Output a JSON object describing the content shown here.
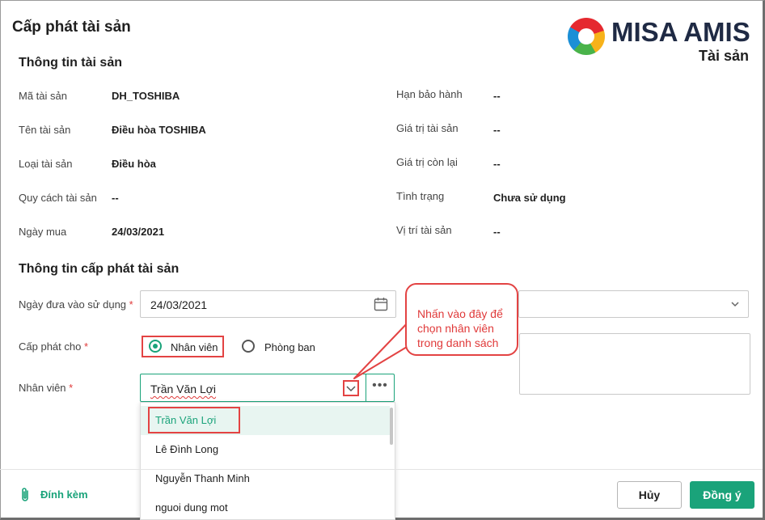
{
  "dialog": {
    "title": "Cấp phát tài sản"
  },
  "logo": {
    "brand": "MISA AMIS",
    "product": "Tài sản"
  },
  "asset_info": {
    "section_title": "Thông tin tài sản",
    "left": [
      {
        "label": "Mã tài sản",
        "value": "DH_TOSHIBA"
      },
      {
        "label": "Tên tài sản",
        "value": "Điều hòa TOSHIBA"
      },
      {
        "label": "Loại tài sản",
        "value": "Điều hòa"
      },
      {
        "label": "Quy cách tài sản",
        "value": "--"
      },
      {
        "label": "Ngày mua",
        "value": "24/03/2021"
      }
    ],
    "right": [
      {
        "label": "Hạn bảo hành",
        "value": "--"
      },
      {
        "label": "Giá trị tài sản",
        "value": "--"
      },
      {
        "label": "Giá trị còn lại",
        "value": "--"
      },
      {
        "label": "Tình trạng",
        "value": "Chưa sử dụng"
      },
      {
        "label": "Vị trí tài sản",
        "value": "--"
      }
    ]
  },
  "allocation": {
    "section_title": "Thông tin cấp phát tài sản",
    "date_label": "Ngày đưa vào sử dụng",
    "date_value": "24/03/2021",
    "assign_label": "Cấp phát cho",
    "radio_employee": "Nhân viên",
    "radio_department": "Phòng ban",
    "employee_label": "Nhân viên",
    "employee_value": "Trần Văn Lợi",
    "required_mark": "*",
    "more_button": "•••"
  },
  "dropdown": {
    "items": [
      "Trần Văn Lợi",
      "Lê Đình Long",
      "Nguyễn Thanh Minh",
      "nguoi dung mot"
    ]
  },
  "callout": {
    "text": "Nhấn vào đây để chọn nhân viên trong danh sách"
  },
  "footer": {
    "attach_label": "Đính kèm",
    "cancel_label": "Hủy",
    "ok_label": "Đồng ý"
  },
  "colors": {
    "accent": "#1aa37a",
    "highlight": "#e34343",
    "required": "#e03a3a"
  }
}
